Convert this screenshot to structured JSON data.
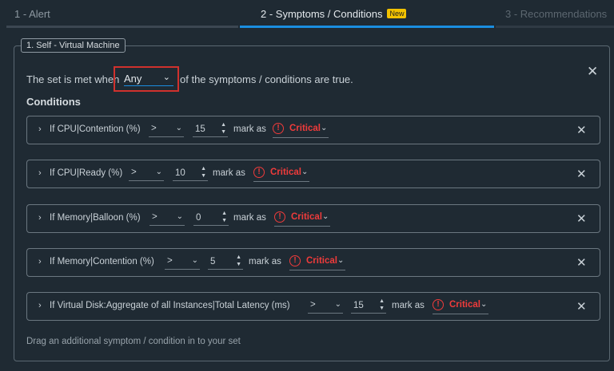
{
  "steps": [
    {
      "label": "1 - Alert"
    },
    {
      "label": "2 - Symptoms / Conditions",
      "badge": "New"
    },
    {
      "label": "3 - Recommendations"
    }
  ],
  "panel": {
    "title": "1. Self - Virtual Machine",
    "set_prefix": "The set is met when",
    "set_value": "Any",
    "set_suffix": "of the symptoms / conditions are true.",
    "conditions_heading": "Conditions",
    "drag_hint": "Drag an additional symptom / condition in to your set"
  },
  "conditions": [
    {
      "label": "If CPU|Contention (%)",
      "operator": ">",
      "value": "15",
      "mark_as": "mark as",
      "severity": "Critical"
    },
    {
      "label": "If CPU|Ready (%)",
      "operator": ">",
      "value": "10",
      "mark_as": "mark as",
      "severity": "Critical"
    },
    {
      "label": "If Memory|Balloon (%)",
      "operator": ">",
      "value": "0",
      "mark_as": "mark as",
      "severity": "Critical"
    },
    {
      "label": "If Memory|Contention (%)",
      "operator": ">",
      "value": "5",
      "mark_as": "mark as",
      "severity": "Critical"
    },
    {
      "label": "If Virtual Disk:Aggregate of all Instances|Total Latency (ms)",
      "operator": ">",
      "value": "15",
      "mark_as": "mark as",
      "severity": "Critical"
    }
  ],
  "colors": {
    "accent": "#1a8ee0",
    "critical": "#ef3b3b",
    "highlight": "#d0312d",
    "badge": "#f2c200"
  },
  "icons": {
    "expand": "chevron-right-icon",
    "close": "close-icon",
    "severity": "exclamation-circle-icon"
  }
}
